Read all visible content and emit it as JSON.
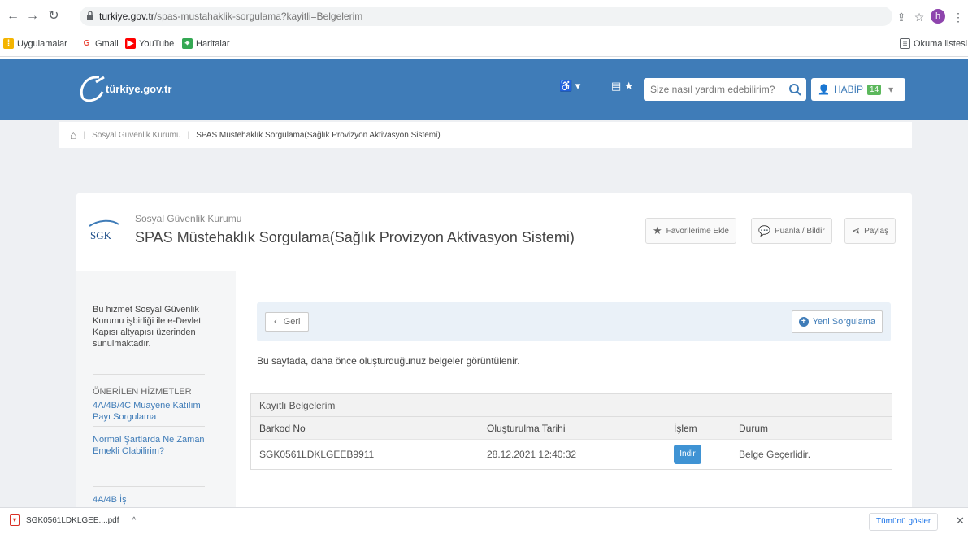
{
  "browser": {
    "url_host": "turkiye.gov.tr",
    "url_path": "/spas-mustahaklik-sorgulama?kayitli=Belgelerim",
    "bookmarks": [
      {
        "label": "Uygulamalar",
        "icon": "apps-grid-icon"
      },
      {
        "label": "Gmail",
        "icon": "google-icon"
      },
      {
        "label": "YouTube",
        "icon": "youtube-icon"
      },
      {
        "label": "Haritalar",
        "icon": "maps-icon"
      }
    ],
    "reading_list": "Okuma listesi",
    "profile_initial": "h"
  },
  "header": {
    "logo_text": "türkiye.gov.tr",
    "search_placeholder": "Size nasıl yardım edebilirim?",
    "user_name": "HABİP",
    "user_badge": "14"
  },
  "breadcrumb": {
    "items": [
      "Sosyal Güvenlik Kurumu",
      "SPAS Müstehaklık Sorgulama(Sağlık Provizyon Aktivasyon Sistemi)"
    ]
  },
  "service": {
    "org": "Sosyal Güvenlik Kurumu",
    "logo_text": "SGK",
    "title": "SPAS Müstehaklık Sorgulama(Sağlık Provizyon Aktivasyon Sistemi)",
    "actions": {
      "favorite": "Favorilerime Ekle",
      "rate": "Puanla / Bildir",
      "share": "Paylaş"
    }
  },
  "sidebar": {
    "intro": "Bu hizmet Sosyal Güvenlik Kurumu işbirliği ile e-Devlet Kapısı altyapısı üzerinden sunulmaktadır.",
    "heading": "ÖNERİLEN HİZMETLER",
    "links": [
      "4A/4B/4C Muayene Katılım Payı Sorgulama",
      "Normal Şartlarda Ne Zaman Emekli Olabilirim?",
      "4A/4B İş"
    ]
  },
  "main": {
    "back": "Geri",
    "new_query": "Yeni Sorgulama",
    "info": "Bu sayfada, daha önce oluşturduğunuz belgeler görüntülenir.",
    "records": {
      "title": "Kayıtlı Belgelerim",
      "columns": [
        "Barkod No",
        "Oluşturulma Tarihi",
        "İşlem",
        "Durum"
      ],
      "rows": [
        {
          "barcode": "SGK0561LDKLGEEB9911",
          "date": "28.12.2021 12:40:32",
          "action": "İndir",
          "status": "Belge Geçerlidir."
        }
      ]
    }
  },
  "downloads": {
    "file": "SGK0561LDKLGEE....pdf",
    "show_all": "Tümünü göster"
  }
}
